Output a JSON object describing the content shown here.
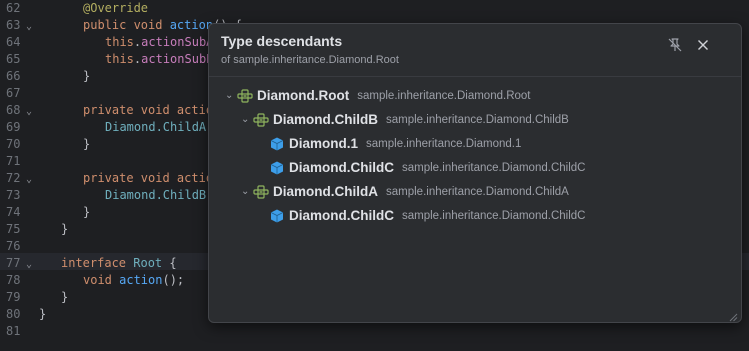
{
  "editor": {
    "lines": [
      {
        "num": "62",
        "fold": ""
      },
      {
        "num": "63",
        "fold": "⌄"
      },
      {
        "num": "64",
        "fold": ""
      },
      {
        "num": "65",
        "fold": ""
      },
      {
        "num": "66",
        "fold": ""
      },
      {
        "num": "67",
        "fold": ""
      },
      {
        "num": "68",
        "fold": "⌄"
      },
      {
        "num": "69",
        "fold": ""
      },
      {
        "num": "70",
        "fold": ""
      },
      {
        "num": "71",
        "fold": ""
      },
      {
        "num": "72",
        "fold": "⌄"
      },
      {
        "num": "73",
        "fold": ""
      },
      {
        "num": "74",
        "fold": ""
      },
      {
        "num": "75",
        "fold": ""
      },
      {
        "num": "76",
        "fold": ""
      },
      {
        "num": "77",
        "fold": "⌄"
      },
      {
        "num": "78",
        "fold": ""
      },
      {
        "num": "79",
        "fold": ""
      },
      {
        "num": "80",
        "fold": ""
      },
      {
        "num": "81",
        "fold": ""
      }
    ],
    "code": {
      "l62": {
        "ann": "@Override"
      },
      "l63": {
        "kw": "public void ",
        "fn": "action",
        "rest": "() {"
      },
      "l64": {
        "kw": "this",
        "rest": ".",
        "fld": "actionSubA"
      },
      "l65": {
        "kw": "this",
        "rest": ".",
        "fld": "actionSubE"
      },
      "l66": {
        "rest": "}"
      },
      "l68": {
        "kw": "private void ",
        "fn": "actio"
      },
      "l69": {
        "typ": "Diamond.ChildA."
      },
      "l70": {
        "rest": "}"
      },
      "l72": {
        "kw": "private void ",
        "fn": "actio"
      },
      "l73": {
        "typ": "Diamond.ChildB."
      },
      "l74": {
        "rest": "}"
      },
      "l75": {
        "rest": "}"
      },
      "l77": {
        "kw": "interface ",
        "typ": "Root",
        "rest": " {"
      },
      "l78": {
        "kw": "void ",
        "fn": "action",
        "rest": "();"
      },
      "l79": {
        "rest": "}"
      },
      "l80": {
        "rest": "}"
      }
    }
  },
  "popup": {
    "title": "Type descendants",
    "subtitle": "of sample.inheritance.Diamond.Root",
    "tree": [
      {
        "name": "Diamond.Root",
        "qualified": "sample.inheritance.Diamond.Root",
        "icon": "interface-icon",
        "arrow": "⌄"
      },
      {
        "name": "Diamond.ChildB",
        "qualified": "sample.inheritance.Diamond.ChildB",
        "icon": "interface-icon",
        "arrow": "⌄"
      },
      {
        "name": "Diamond.1",
        "qualified": "sample.inheritance.Diamond.1",
        "icon": "class-icon",
        "arrow": ""
      },
      {
        "name": "Diamond.ChildC",
        "qualified": "sample.inheritance.Diamond.ChildC",
        "icon": "class-icon",
        "arrow": ""
      },
      {
        "name": "Diamond.ChildA",
        "qualified": "sample.inheritance.Diamond.ChildA",
        "icon": "interface-icon",
        "arrow": "⌄"
      },
      {
        "name": "Diamond.ChildC",
        "qualified": "sample.inheritance.Diamond.ChildC",
        "icon": "class-icon",
        "arrow": ""
      }
    ]
  },
  "colors": {
    "background": "#1e1f22",
    "popup_bg": "#2b2d30",
    "keyword": "#cf8e6d",
    "annotation": "#b3ae60",
    "field": "#c77dbb",
    "type": "#6fafbd",
    "interface_icon": "#8fb55e",
    "class_icon": "#3d9ee9"
  }
}
